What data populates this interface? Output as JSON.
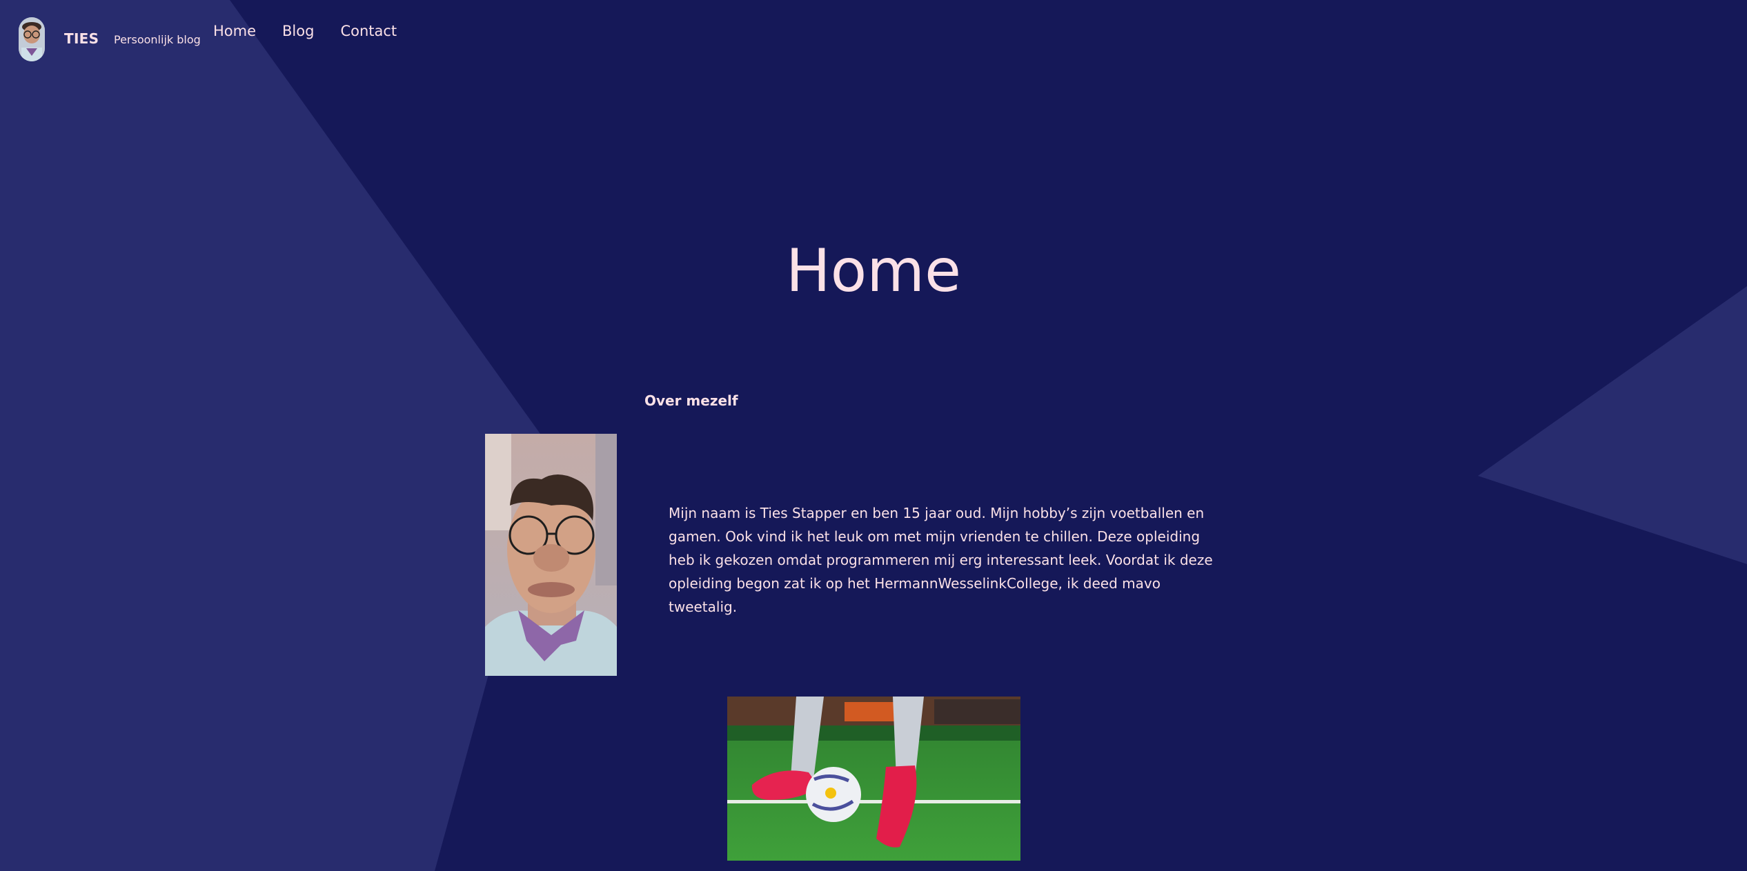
{
  "colors": {
    "background": "#151858",
    "shape": "#282c6e",
    "text": "#fbe1e7"
  },
  "header": {
    "site_title": "TIES",
    "tagline": "Persoonlijk blog",
    "nav": [
      {
        "label": "Home"
      },
      {
        "label": "Blog"
      },
      {
        "label": "Contact"
      }
    ]
  },
  "main": {
    "title": "Home",
    "section_heading": "Over mezelf",
    "about_text": "Mijn naam is Ties Stapper en ben 15 jaar oud. Mijn hobby’s zijn voetballen en gamen. Ook vind ik het leuk om met mijn vrienden te chillen. Deze opleiding heb ik gekozen omdat programmeren mij erg interessant leek. Voordat ik deze opleiding begon zat ik op het HermannWesselinkCollege, ik deed mavo tweetalig."
  }
}
